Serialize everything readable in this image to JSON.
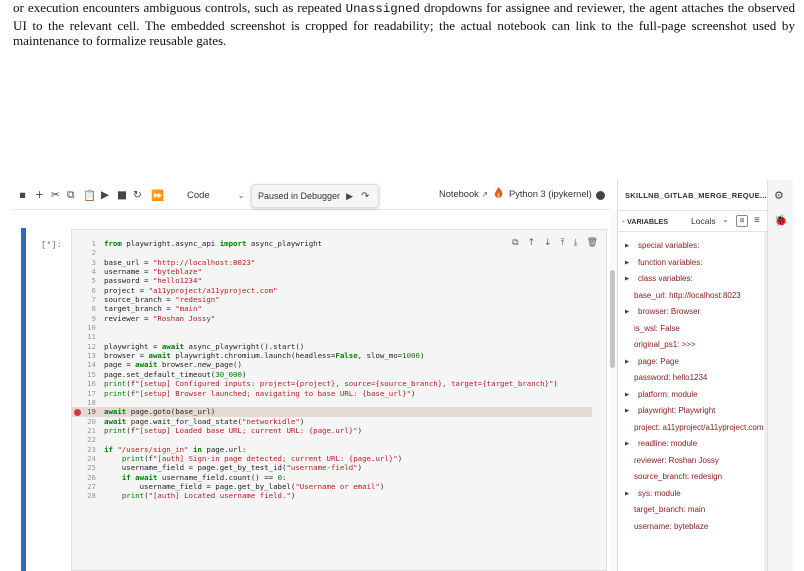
{
  "paper": {
    "line1_a": "or execution encounters ambiguous controls, such as repeated ",
    "line1_code": "Unassigned",
    "line1_b": " dropdowns for assignee",
    "rest": "and reviewer, the agent attaches the observed UI to the relevant cell. The embedded screenshot is cropped for readability; the actual notebook can link to the full-page screenshot used by maintenance to formalize reusable gates."
  },
  "toolbar": {
    "cell_type": "Code",
    "debug_status": "Paused in Debugger",
    "notebook_label": "Notebook",
    "kernel_label": "Python 3 (ipykernel)"
  },
  "cell": {
    "prompt": "[*]:",
    "breakpoint_line": 19,
    "lines": [
      "from playwright.async_api import async_playwright",
      "",
      "base_url = \"http://localhost:8023\"",
      "username = \"byteblaze\"",
      "password = \"hello1234\"",
      "project = \"a11yproject/a11yproject.com\"",
      "source_branch = \"redesign\"",
      "target_branch = \"main\"",
      "reviewer = \"Roshan Jossy\"",
      "",
      "",
      "playwright = await async_playwright().start()",
      "browser = await playwright.chromium.launch(headless=False, slow_mo=1000)",
      "page = await browser.new_page()",
      "page.set_default_timeout(30_000)",
      "print(f\"[setup] Configured inputs: project={project}, source={source_branch}, target={target_branch}\")",
      "print(f\"[setup] Browser launched; navigating to base URL: {base_url}\")",
      "",
      "await page.goto(base_url)",
      "await page.wait_for_load_state(\"networkidle\")",
      "print(f\"[setup] Loaded base URL; current URL: {page.url}\")",
      "",
      "if \"/users/sign_in\" in page.url:",
      "    print(f\"[auth] Sign-in page detected; current URL: {page.url}\")",
      "    username_field = page.get_by_test_id(\"username-field\")",
      "    if await username_field.count() == 0:",
      "        username_field = page.get_by_label(\"Username or email\")",
      "    print(\"[auth] Located username field.\")"
    ]
  },
  "sidebar": {
    "title": "SKILLNB_GITLAB_MERGE_REQUE...",
    "section_label": "VARIABLES",
    "scope": "Locals",
    "variables": [
      {
        "text": "special variables:",
        "expandable": true
      },
      {
        "text": "function variables:",
        "expandable": true
      },
      {
        "text": "class variables:",
        "expandable": true
      },
      {
        "text": "base_url: http://localhost:8023",
        "expandable": false
      },
      {
        "text": "browser: Browser",
        "expandable": true
      },
      {
        "text": "is_wsl: False",
        "expandable": false
      },
      {
        "text": "original_ps1: >>>",
        "expandable": false
      },
      {
        "text": "page: Page",
        "expandable": true
      },
      {
        "text": "password: hello1234",
        "expandable": false
      },
      {
        "text": "platform: module",
        "expandable": true
      },
      {
        "text": "playwright: Playwright",
        "expandable": true
      },
      {
        "text": "project: a11yproject/a11yproject.com",
        "expandable": false
      },
      {
        "text": "readline: module",
        "expandable": true
      },
      {
        "text": "reviewer: Roshan Jossy",
        "expandable": false
      },
      {
        "text": "source_branch: redesign",
        "expandable": false
      },
      {
        "text": "sys: module",
        "expandable": true
      },
      {
        "text": "target_branch: main",
        "expandable": false
      },
      {
        "text": "username: byteblaze",
        "expandable": false
      }
    ]
  },
  "colors": {
    "accent": "#2a6ebb",
    "breakpoint": "#d43b3b",
    "variable_text": "#8b1a1a"
  }
}
